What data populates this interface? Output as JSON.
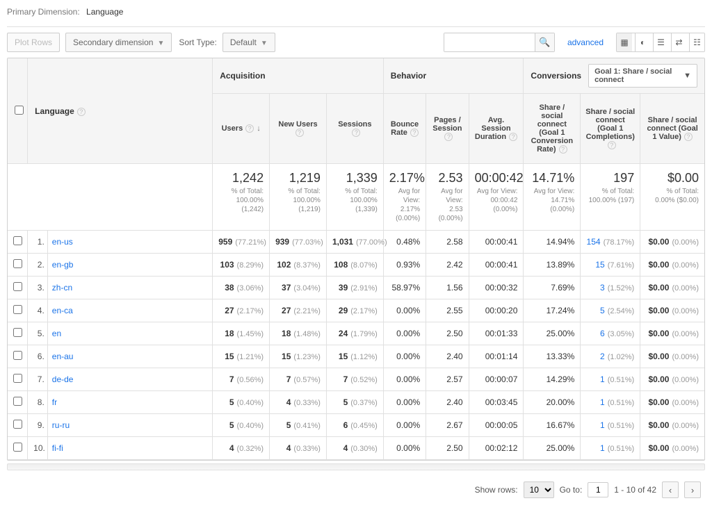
{
  "primaryDimension": {
    "label": "Primary Dimension:",
    "value": "Language"
  },
  "toolbar": {
    "plotRows": "Plot Rows",
    "secondaryDim": "Secondary dimension",
    "sortTypeLabel": "Sort Type:",
    "sortType": "Default",
    "advanced": "advanced",
    "searchPlaceholder": ""
  },
  "groups": {
    "acquisition": "Acquisition",
    "behavior": "Behavior",
    "conversions": "Conversions"
  },
  "goalSelector": "Goal 1: Share / social connect",
  "columns": {
    "primary": "Language",
    "users": "Users",
    "newUsers": "New Users",
    "sessions": "Sessions",
    "bounce": "Bounce Rate",
    "pps": "Pages / Session",
    "dur": "Avg. Session Duration",
    "convRate": "Share / social connect (Goal 1 Conversion Rate)",
    "completions": "Share / social connect (Goal 1 Completions)",
    "value": "Share / social connect (Goal 1 Value)"
  },
  "totals": {
    "users": {
      "v": "1,242",
      "sub": "% of Total: 100.00% (1,242)"
    },
    "newUsers": {
      "v": "1,219",
      "sub": "% of Total: 100.00% (1,219)"
    },
    "sessions": {
      "v": "1,339",
      "sub": "% of Total: 100.00% (1,339)"
    },
    "bounce": {
      "v": "2.17%",
      "sub": "Avg for View: 2.17% (0.00%)"
    },
    "pps": {
      "v": "2.53",
      "sub": "Avg for View: 2.53 (0.00%)"
    },
    "dur": {
      "v": "00:00:42",
      "sub": "Avg for View: 00:00:42 (0.00%)"
    },
    "convRate": {
      "v": "14.71%",
      "sub": "Avg for View: 14.71% (0.00%)"
    },
    "completions": {
      "v": "197",
      "sub": "% of Total: 100.00% (197)"
    },
    "value": {
      "v": "$0.00",
      "sub": "% of Total: 0.00% ($0.00)"
    }
  },
  "rows": [
    {
      "i": "1.",
      "name": "en-us",
      "users": {
        "v": "959",
        "p": "(77.21%)"
      },
      "nu": {
        "v": "939",
        "p": "(77.03%)"
      },
      "sess": {
        "v": "1,031",
        "p": "(77.00%)"
      },
      "br": "0.48%",
      "pps": "2.58",
      "dur": "00:00:41",
      "cr": "14.94%",
      "comp": {
        "v": "154",
        "p": "(78.17%)"
      },
      "val": {
        "v": "$0.00",
        "p": "(0.00%)"
      }
    },
    {
      "i": "2.",
      "name": "en-gb",
      "users": {
        "v": "103",
        "p": "(8.29%)"
      },
      "nu": {
        "v": "102",
        "p": "(8.37%)"
      },
      "sess": {
        "v": "108",
        "p": "(8.07%)"
      },
      "br": "0.93%",
      "pps": "2.42",
      "dur": "00:00:41",
      "cr": "13.89%",
      "comp": {
        "v": "15",
        "p": "(7.61%)"
      },
      "val": {
        "v": "$0.00",
        "p": "(0.00%)"
      }
    },
    {
      "i": "3.",
      "name": "zh-cn",
      "users": {
        "v": "38",
        "p": "(3.06%)"
      },
      "nu": {
        "v": "37",
        "p": "(3.04%)"
      },
      "sess": {
        "v": "39",
        "p": "(2.91%)"
      },
      "br": "58.97%",
      "pps": "1.56",
      "dur": "00:00:32",
      "cr": "7.69%",
      "comp": {
        "v": "3",
        "p": "(1.52%)"
      },
      "val": {
        "v": "$0.00",
        "p": "(0.00%)"
      }
    },
    {
      "i": "4.",
      "name": "en-ca",
      "users": {
        "v": "27",
        "p": "(2.17%)"
      },
      "nu": {
        "v": "27",
        "p": "(2.21%)"
      },
      "sess": {
        "v": "29",
        "p": "(2.17%)"
      },
      "br": "0.00%",
      "pps": "2.55",
      "dur": "00:00:20",
      "cr": "17.24%",
      "comp": {
        "v": "5",
        "p": "(2.54%)"
      },
      "val": {
        "v": "$0.00",
        "p": "(0.00%)"
      }
    },
    {
      "i": "5.",
      "name": "en",
      "users": {
        "v": "18",
        "p": "(1.45%)"
      },
      "nu": {
        "v": "18",
        "p": "(1.48%)"
      },
      "sess": {
        "v": "24",
        "p": "(1.79%)"
      },
      "br": "0.00%",
      "pps": "2.50",
      "dur": "00:01:33",
      "cr": "25.00%",
      "comp": {
        "v": "6",
        "p": "(3.05%)"
      },
      "val": {
        "v": "$0.00",
        "p": "(0.00%)"
      }
    },
    {
      "i": "6.",
      "name": "en-au",
      "users": {
        "v": "15",
        "p": "(1.21%)"
      },
      "nu": {
        "v": "15",
        "p": "(1.23%)"
      },
      "sess": {
        "v": "15",
        "p": "(1.12%)"
      },
      "br": "0.00%",
      "pps": "2.40",
      "dur": "00:01:14",
      "cr": "13.33%",
      "comp": {
        "v": "2",
        "p": "(1.02%)"
      },
      "val": {
        "v": "$0.00",
        "p": "(0.00%)"
      }
    },
    {
      "i": "7.",
      "name": "de-de",
      "users": {
        "v": "7",
        "p": "(0.56%)"
      },
      "nu": {
        "v": "7",
        "p": "(0.57%)"
      },
      "sess": {
        "v": "7",
        "p": "(0.52%)"
      },
      "br": "0.00%",
      "pps": "2.57",
      "dur": "00:00:07",
      "cr": "14.29%",
      "comp": {
        "v": "1",
        "p": "(0.51%)"
      },
      "val": {
        "v": "$0.00",
        "p": "(0.00%)"
      }
    },
    {
      "i": "8.",
      "name": "fr",
      "users": {
        "v": "5",
        "p": "(0.40%)"
      },
      "nu": {
        "v": "4",
        "p": "(0.33%)"
      },
      "sess": {
        "v": "5",
        "p": "(0.37%)"
      },
      "br": "0.00%",
      "pps": "2.40",
      "dur": "00:03:45",
      "cr": "20.00%",
      "comp": {
        "v": "1",
        "p": "(0.51%)"
      },
      "val": {
        "v": "$0.00",
        "p": "(0.00%)"
      }
    },
    {
      "i": "9.",
      "name": "ru-ru",
      "users": {
        "v": "5",
        "p": "(0.40%)"
      },
      "nu": {
        "v": "5",
        "p": "(0.41%)"
      },
      "sess": {
        "v": "6",
        "p": "(0.45%)"
      },
      "br": "0.00%",
      "pps": "2.67",
      "dur": "00:00:05",
      "cr": "16.67%",
      "comp": {
        "v": "1",
        "p": "(0.51%)"
      },
      "val": {
        "v": "$0.00",
        "p": "(0.00%)"
      }
    },
    {
      "i": "10.",
      "name": "fi-fi",
      "users": {
        "v": "4",
        "p": "(0.32%)"
      },
      "nu": {
        "v": "4",
        "p": "(0.33%)"
      },
      "sess": {
        "v": "4",
        "p": "(0.30%)"
      },
      "br": "0.00%",
      "pps": "2.50",
      "dur": "00:02:12",
      "cr": "25.00%",
      "comp": {
        "v": "1",
        "p": "(0.51%)"
      },
      "val": {
        "v": "$0.00",
        "p": "(0.00%)"
      }
    }
  ],
  "footer": {
    "showRows": "Show rows:",
    "rowsValue": "10",
    "goTo": "Go to:",
    "goToValue": "1",
    "range": "1 - 10 of 42"
  }
}
